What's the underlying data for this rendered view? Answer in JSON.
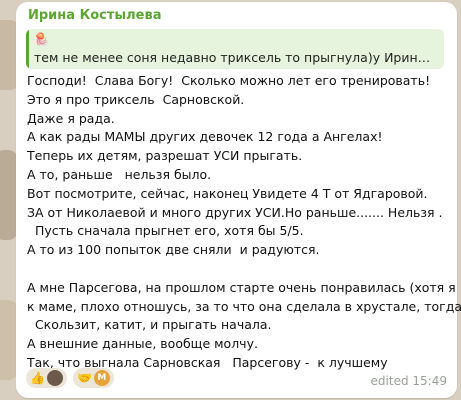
{
  "message": {
    "sender": "Ирина Костылева",
    "reply": {
      "emoji": "🪼",
      "text": "тем не менее соня недавно триксель то прыгнула)у Ирины н..."
    },
    "lines": [
      "Господи!  Слава Богу!  Сколько можно лет его тренировать!",
      "Это я про триксель  Сарновской.",
      "Даже я рада.",
      "А как рады МАМЫ других девочек 12 года а Ангелах!",
      "Теперь их детям, разрешат УСИ прыгать.",
      "А то, раньше   нельзя было.",
      "Вот посмотрите, сейчас, наконец Увидете 4 Т от Ядгаровой.",
      "ЗА от Николаевой и много других УСИ.Но раньше....... Нельзя .",
      "  Пусть сначала прыгнет его, хотя бы 5/5.",
      "А то из 100 попыток две сняли  и радуются.",
      "",
      "А мне Парсегова, на прошлом старте очень понравилась (хотя я",
      "к маме, плохо отношусь, за то что она сделала в хрустале, тогда)",
      "  Скользит, катит, и прыгать начала.",
      "А внешние данные, вообще молчу.",
      "Так, что выгнала Сарновская   Парсегову -  к лучшему"
    ],
    "reactions": [
      {
        "emoji": "👍",
        "avatar": "photo"
      },
      {
        "emoji": "🤝",
        "avatar": "М"
      }
    ],
    "edited_label": "edited",
    "time": "15:49"
  }
}
